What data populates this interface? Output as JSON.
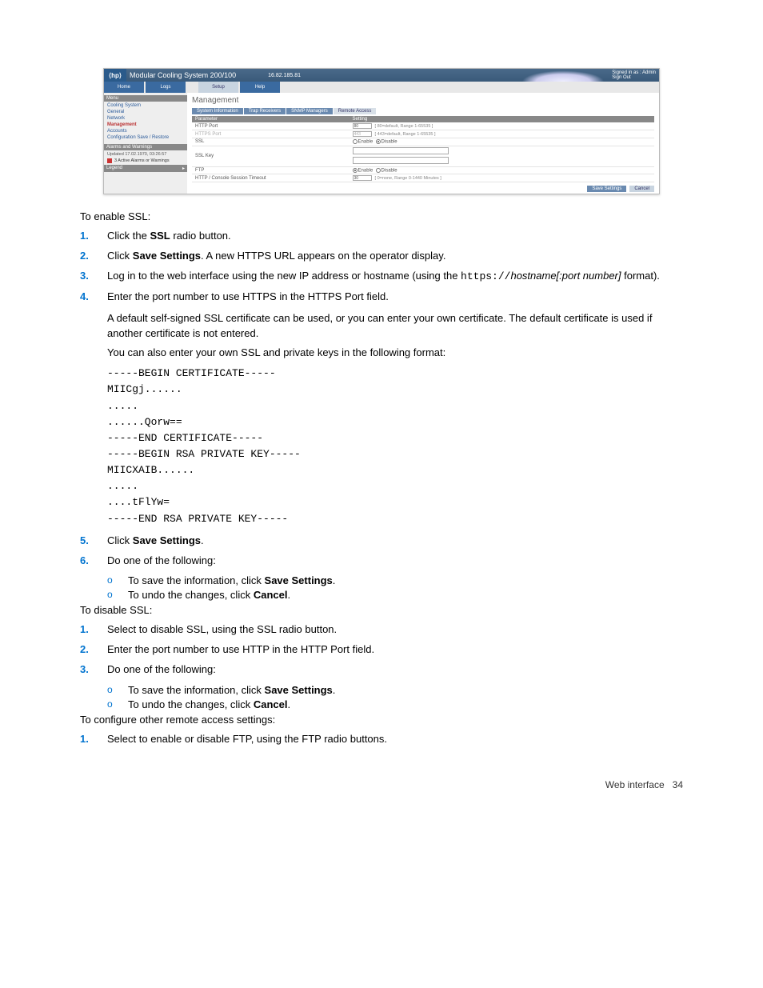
{
  "shot": {
    "logo": "hp",
    "product": "Modular Cooling System 200/100",
    "ip": "16.82.185.81",
    "signin_line1": "Signed in as : Admin",
    "signin_line2": "Sign Out",
    "top_tabs": {
      "home": "Home",
      "logs": "Logs",
      "setup": "Setup",
      "help": "Help"
    },
    "side": {
      "menu_hdr": "Menu",
      "items": [
        "Cooling System",
        "General",
        "Network",
        "Management",
        "Accounts",
        "Configuration Save / Restore"
      ],
      "alarms_hdr": "Alarms and Warnings",
      "updated": "Updated 17.02.1970, 03:26:57",
      "active": "3 Active Alarms or Warnings",
      "legend": "Legend"
    },
    "content": {
      "heading": "Management",
      "subtabs": [
        "System Information",
        "Trap Receivers",
        "SNMP Managers",
        "Remote Access"
      ],
      "col_param": "Parameter",
      "col_setting": "Setting",
      "rows": {
        "http_port": {
          "label": "HTTP Port",
          "value": "80",
          "range": "[ 80=default, Range 1-65535 ]"
        },
        "https_port": {
          "label": "HTTPS Port",
          "value": "443",
          "range": "[ 443=default, Range 1-65535 ]"
        },
        "ssl": {
          "label": "SSL",
          "enable": "Enable",
          "disable": "Disable"
        },
        "ssl_key": {
          "label": "SSL Key"
        },
        "ftp": {
          "label": "FTP",
          "enable": "Enable",
          "disable": "Disable"
        },
        "timeout": {
          "label": "HTTP / Console Session Timeout",
          "value": "30",
          "range": "[ 0=none, Range 0-1440 Minutes ]"
        }
      },
      "save": "Save Settings",
      "cancel": "Cancel"
    }
  },
  "body": {
    "enable_lead": "To enable SSL:",
    "en1_a": "Click the ",
    "en1_b": "SSL",
    "en1_c": " radio button.",
    "en2_a": "Click ",
    "en2_b": "Save Settings",
    "en2_c": ". A new HTTPS URL appears on the operator display.",
    "en3_a": "Log in to the web interface using the new IP address or hostname (using the ",
    "en3_code": "https://",
    "en3_b": "hostname[:port number]",
    "en3_c": " format).",
    "en4": "Enter the port number to use HTTPS in the HTTPS Port field.",
    "en4_p1": "A default self-signed SSL certificate can be used, or you can enter your own certificate. The default certificate is used if another certificate is not entered.",
    "en4_p2": "You can also enter your own SSL and private keys in the following format:",
    "cert": "-----BEGIN CERTIFICATE-----\nMIICgj......\n.....\n......Qorw==\n-----END CERTIFICATE-----\n-----BEGIN RSA PRIVATE KEY-----\nMIICXAIB......\n.....\n....tFlYw=\n-----END RSA PRIVATE KEY-----",
    "en5_a": "Click ",
    "en5_b": "Save Settings",
    "en5_c": ".",
    "en6": "Do one of the following:",
    "sub_save_a": "To save the information, click ",
    "sub_save_b": "Save Settings",
    "sub_save_c": ".",
    "sub_cancel_a": "To undo the changes, click ",
    "sub_cancel_b": "Cancel",
    "sub_cancel_c": ".",
    "disable_lead": "To disable SSL:",
    "dis1": "Select to disable SSL, using the SSL radio button.",
    "dis2": "Enter the port number to use HTTP in the HTTP Port field.",
    "dis3": "Do one of the following:",
    "other_lead": "To configure other remote access settings:",
    "oth1": "Select to enable or disable FTP, using the FTP radio buttons.",
    "footer_label": "Web interface",
    "footer_page": "34",
    "marks": {
      "n1": "1.",
      "n2": "2.",
      "n3": "3.",
      "n4": "4.",
      "n5": "5.",
      "n6": "6.",
      "circ": "o"
    }
  }
}
